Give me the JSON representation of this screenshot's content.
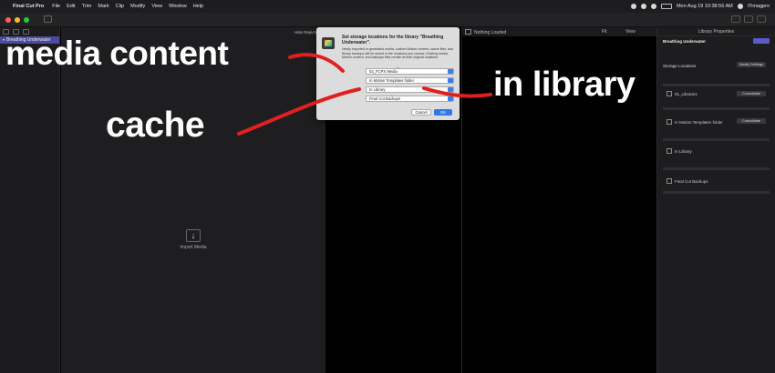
{
  "menubar": {
    "apple": "",
    "app_name": "Final Cut Pro",
    "items": [
      "File",
      "Edit",
      "Trim",
      "Mark",
      "Clip",
      "Modify",
      "View",
      "Window",
      "Help"
    ],
    "clock": "Mon Aug 19  10:38:56 AM",
    "user": "iTimagpro"
  },
  "sidebar": {
    "items": [
      {
        "label": "Breathing Underwater",
        "selected": true
      },
      {
        "label": "",
        "selected": false
      }
    ]
  },
  "browser": {
    "header_filter": "Hide Rejected",
    "import_icon": "↓",
    "import_label": "Import Media"
  },
  "viewer": {
    "status": "Nothing Loaded",
    "fit": "Fit",
    "view": "View"
  },
  "inspector": {
    "title": "Library Properties",
    "library_name": "Breathing Underwater",
    "storage_locations": "Storage Locations",
    "modify_button": "Modify Settings",
    "media_value": "01_Libraries",
    "motion_value": "In Motion Templates folder",
    "cache_value": "In Library",
    "backups_value": "Final Cut Backups",
    "consolidate": "Consolidate"
  },
  "dialog": {
    "title": "Set storage locations for the library \"Breathing Underwater\".",
    "description": "Newly imported or generated media, custom Motion content, cache files, and library backups will be stored in the locations you choose. Existing media, Motion content, and backups files remain at their original locations.",
    "fields": [
      {
        "label": "Media:",
        "value": "03_FCPX Media"
      },
      {
        "label": "Motion Content:",
        "value": "In Motion Templates folder"
      },
      {
        "label": "Cache:",
        "value": "In Library"
      },
      {
        "label": "Backups:",
        "value": "Final Cut Backups"
      }
    ],
    "cancel": "Cancel",
    "ok": "OK"
  },
  "annotations": {
    "media_content": "media content",
    "cache": "cache",
    "in_library": "in library",
    "arrow_color": "#e02020"
  }
}
